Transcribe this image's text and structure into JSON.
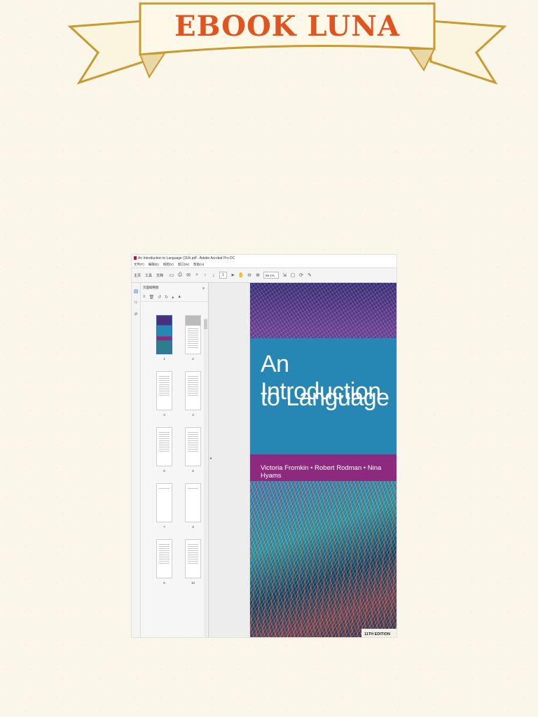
{
  "banner": {
    "text": "EBOOK LUNA"
  },
  "window": {
    "title": "An Introduction to Language (11th.pdf - Adobe Acrobat Pro DC",
    "menu": [
      "文件(F)",
      "编辑(E)",
      "视图(V)",
      "窗口(W)",
      "帮助(H)"
    ],
    "tabs": [
      "主页",
      "工具",
      "文档"
    ],
    "page_number": "1",
    "zoom": "56.1%"
  },
  "thumbnail_panel": {
    "title": "页面缩略图",
    "close": "X",
    "pages": [
      "1",
      "2",
      "3",
      "4",
      "5",
      "6",
      "7",
      "8",
      "9",
      "10"
    ]
  },
  "cover": {
    "title_line1_pre": "An ",
    "title_line1_main": "Introduction",
    "title_line2": "to Language",
    "authors": "Victoria Fromkin • Robert Rodman • Nina Hyams",
    "edition": "11TH EDITION"
  }
}
